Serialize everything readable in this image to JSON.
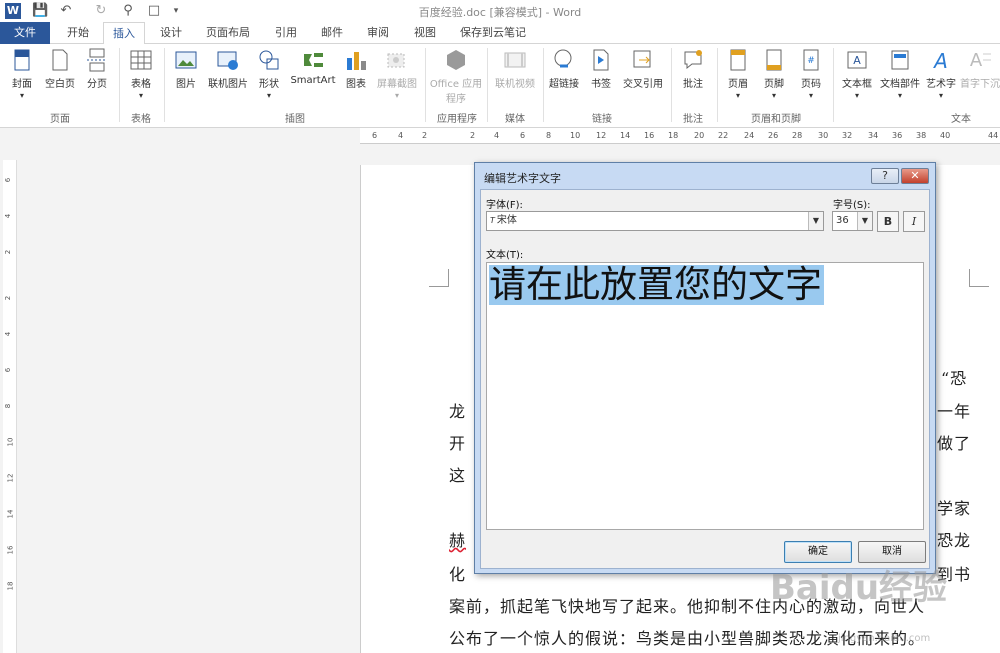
{
  "window": {
    "title": "百度经验.doc [兼容模式] - Word"
  },
  "quick_access": {
    "word_icon": "W",
    "save_icon": "save-icon",
    "undo_icon": "undo-icon",
    "redo_icon": "redo-icon",
    "print_preview_icon": "print-preview-icon",
    "new_icon": "new-doc-icon",
    "more_icon": "▾"
  },
  "tabs": {
    "file": "文件",
    "home": "开始",
    "insert": "插入",
    "design": "设计",
    "layout": "页面布局",
    "references": "引用",
    "mailings": "邮件",
    "review": "审阅",
    "view": "视图",
    "save_cloud": "保存到云笔记"
  },
  "ribbon": {
    "cover": "封面",
    "blank_page": "空白页",
    "page_break": "分页",
    "table": "表格",
    "picture": "图片",
    "online_picture": "联机图片",
    "shapes": "形状",
    "smartart": "SmartArt",
    "chart": "图表",
    "screenshot": "屏幕截图",
    "office_apps": "Office 应用程序",
    "online_video": "联机视频",
    "hyperlink": "超链接",
    "bookmark": "书签",
    "cross_ref": "交叉引用",
    "comment": "批注",
    "header": "页眉",
    "footer": "页脚",
    "page_number": "页码",
    "textbox": "文本框",
    "quick_parts": "文档部件",
    "wordart": "艺术字",
    "dropcap": "首字下沉",
    "groups": {
      "pages": "页面",
      "tables": "表格",
      "illustrations": "插图",
      "apps": "应用程序",
      "media": "媒体",
      "links": "链接",
      "comments": "批注",
      "header_footer": "页眉和页脚",
      "text": "文本"
    }
  },
  "ruler_top": [
    "6",
    "4",
    "2",
    "2",
    "4",
    "6",
    "8",
    "10",
    "12",
    "14",
    "16",
    "18",
    "20",
    "22",
    "24",
    "26",
    "28",
    "30",
    "32",
    "34",
    "36",
    "38",
    "40",
    "44"
  ],
  "ruler_left": [
    "6",
    "4",
    "2",
    "2",
    "4",
    "6",
    "8",
    "10",
    "12",
    "14",
    "16",
    "18"
  ],
  "document": {
    "lines": [
      "“恐",
      "龙",
      "一年",
      "开",
      "做了",
      "这",
      "学家",
      "赫",
      "恐龙",
      "化",
      "到书",
      "案前，抓起笔飞快地写了起来。他抑制不住内心的激动，向世人",
      "公布了一个惊人的假说：鸟类是由小型兽脚类恐龙演化而来的。"
    ]
  },
  "dialog": {
    "title": "编辑艺术字文字",
    "help": "?",
    "close": "✕",
    "font_label": "字体(F):",
    "font_value": "宋体",
    "size_label": "字号(S):",
    "size_value": "36",
    "bold": "B",
    "italic": "I",
    "text_label": "文本(T):",
    "text_value": "请在此放置您的文字",
    "ok": "确定",
    "cancel": "取消"
  },
  "watermark": {
    "brand": "Baidu经验",
    "url": "jingyan.baidu.com"
  }
}
